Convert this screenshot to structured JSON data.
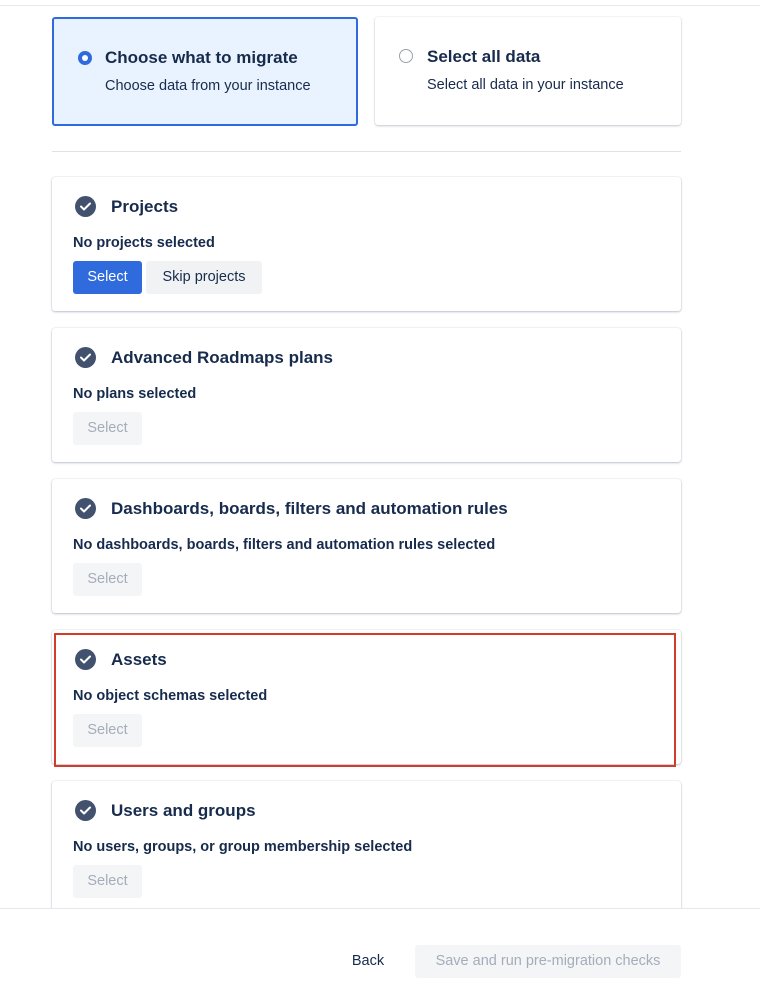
{
  "migration_options": {
    "choose": {
      "title": "Choose what to migrate",
      "description": "Choose data from your instance",
      "selected": true
    },
    "select_all": {
      "title": "Select all data",
      "description": "Select all data in your instance",
      "selected": false
    }
  },
  "sections": {
    "projects": {
      "title": "Projects",
      "status": "No projects selected",
      "select_label": "Select",
      "skip_label": "Skip projects"
    },
    "plans": {
      "title": "Advanced Roadmaps plans",
      "status": "No plans selected",
      "select_label": "Select"
    },
    "dashboards": {
      "title": "Dashboards, boards, filters and automation rules",
      "status": "No dashboards, boards, filters and automation rules selected",
      "select_label": "Select"
    },
    "assets": {
      "title": "Assets",
      "status": "No object schemas selected",
      "select_label": "Select"
    },
    "users": {
      "title": "Users and groups",
      "status": "No users, groups, or group membership selected",
      "select_label": "Select"
    }
  },
  "footer": {
    "back_label": "Back",
    "run_label": "Save and run pre-migration checks"
  },
  "colors": {
    "primary": "#2f6bdc",
    "selected_bg": "#e9f2ff",
    "highlight": "#d23c2a",
    "icon": "#42526e"
  }
}
